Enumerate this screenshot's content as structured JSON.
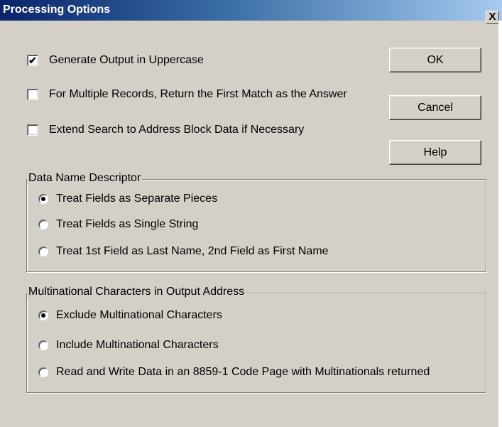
{
  "window": {
    "title": "Processing Options",
    "close_glyph": "X"
  },
  "options": {
    "uppercase": {
      "label": "Generate Output in Uppercase",
      "checked": true
    },
    "first_match": {
      "label": "For Multiple Records, Return the First Match as the Answer",
      "checked": false
    },
    "extend_search": {
      "label": "Extend Search to Address Block Data if Necessary",
      "checked": false
    }
  },
  "buttons": {
    "ok": "OK",
    "cancel": "Cancel",
    "help": "Help"
  },
  "data_name_descriptor": {
    "title": "Data Name Descriptor",
    "items": [
      {
        "label": "Treat Fields as Separate Pieces",
        "selected": true
      },
      {
        "label": "Treat Fields as Single String",
        "selected": false
      },
      {
        "label": "Treat 1st Field as Last Name, 2nd Field as First Name",
        "selected": false
      }
    ]
  },
  "multinational": {
    "title": "Multinational Characters in Output Address",
    "items": [
      {
        "label": "Exclude Multinational Characters",
        "selected": true
      },
      {
        "label": "Include Multinational Characters",
        "selected": false
      },
      {
        "label": "Read and Write Data in an 8859-1 Code Page with Multinationals returned",
        "selected": false
      }
    ]
  },
  "check_glyph": "✔"
}
